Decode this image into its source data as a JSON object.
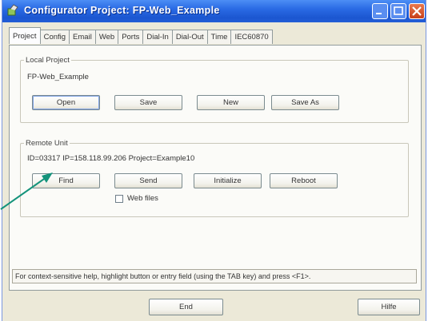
{
  "window": {
    "title": "Configurator Project: FP-Web_Example",
    "icons": {
      "app": "app-icon",
      "minimize": "minimize-icon",
      "maximize": "maximize-icon",
      "close": "close-icon"
    }
  },
  "tabs": [
    {
      "label": "Project",
      "active": true
    },
    {
      "label": "Config"
    },
    {
      "label": "Email"
    },
    {
      "label": "Web"
    },
    {
      "label": "Ports"
    },
    {
      "label": "Dial-In"
    },
    {
      "label": "Dial-Out"
    },
    {
      "label": "Time"
    },
    {
      "label": "IEC60870"
    }
  ],
  "local_project": {
    "legend": "Local Project",
    "project_name": "FP-Web_Example",
    "buttons": {
      "open": "Open",
      "save": "Save",
      "new": "New",
      "save_as": "Save As"
    }
  },
  "remote_unit": {
    "legend": "Remote Unit",
    "info": "ID=03317  IP=158.118.99.206  Project=Example10",
    "buttons": {
      "find": "Find",
      "send": "Send",
      "initialize": "Initialize",
      "reboot": "Reboot"
    },
    "web_files": {
      "label": "Web files",
      "checked": false
    }
  },
  "status_text": "For context-sensitive help, highlight button or entry field (using the TAB key) and press <F1>.",
  "footer": {
    "end": "End",
    "help": "Hilfe"
  },
  "colors": {
    "annotation_arrow": "#14937b",
    "titlebar": "#245ed7",
    "close_button": "#c8401a"
  }
}
